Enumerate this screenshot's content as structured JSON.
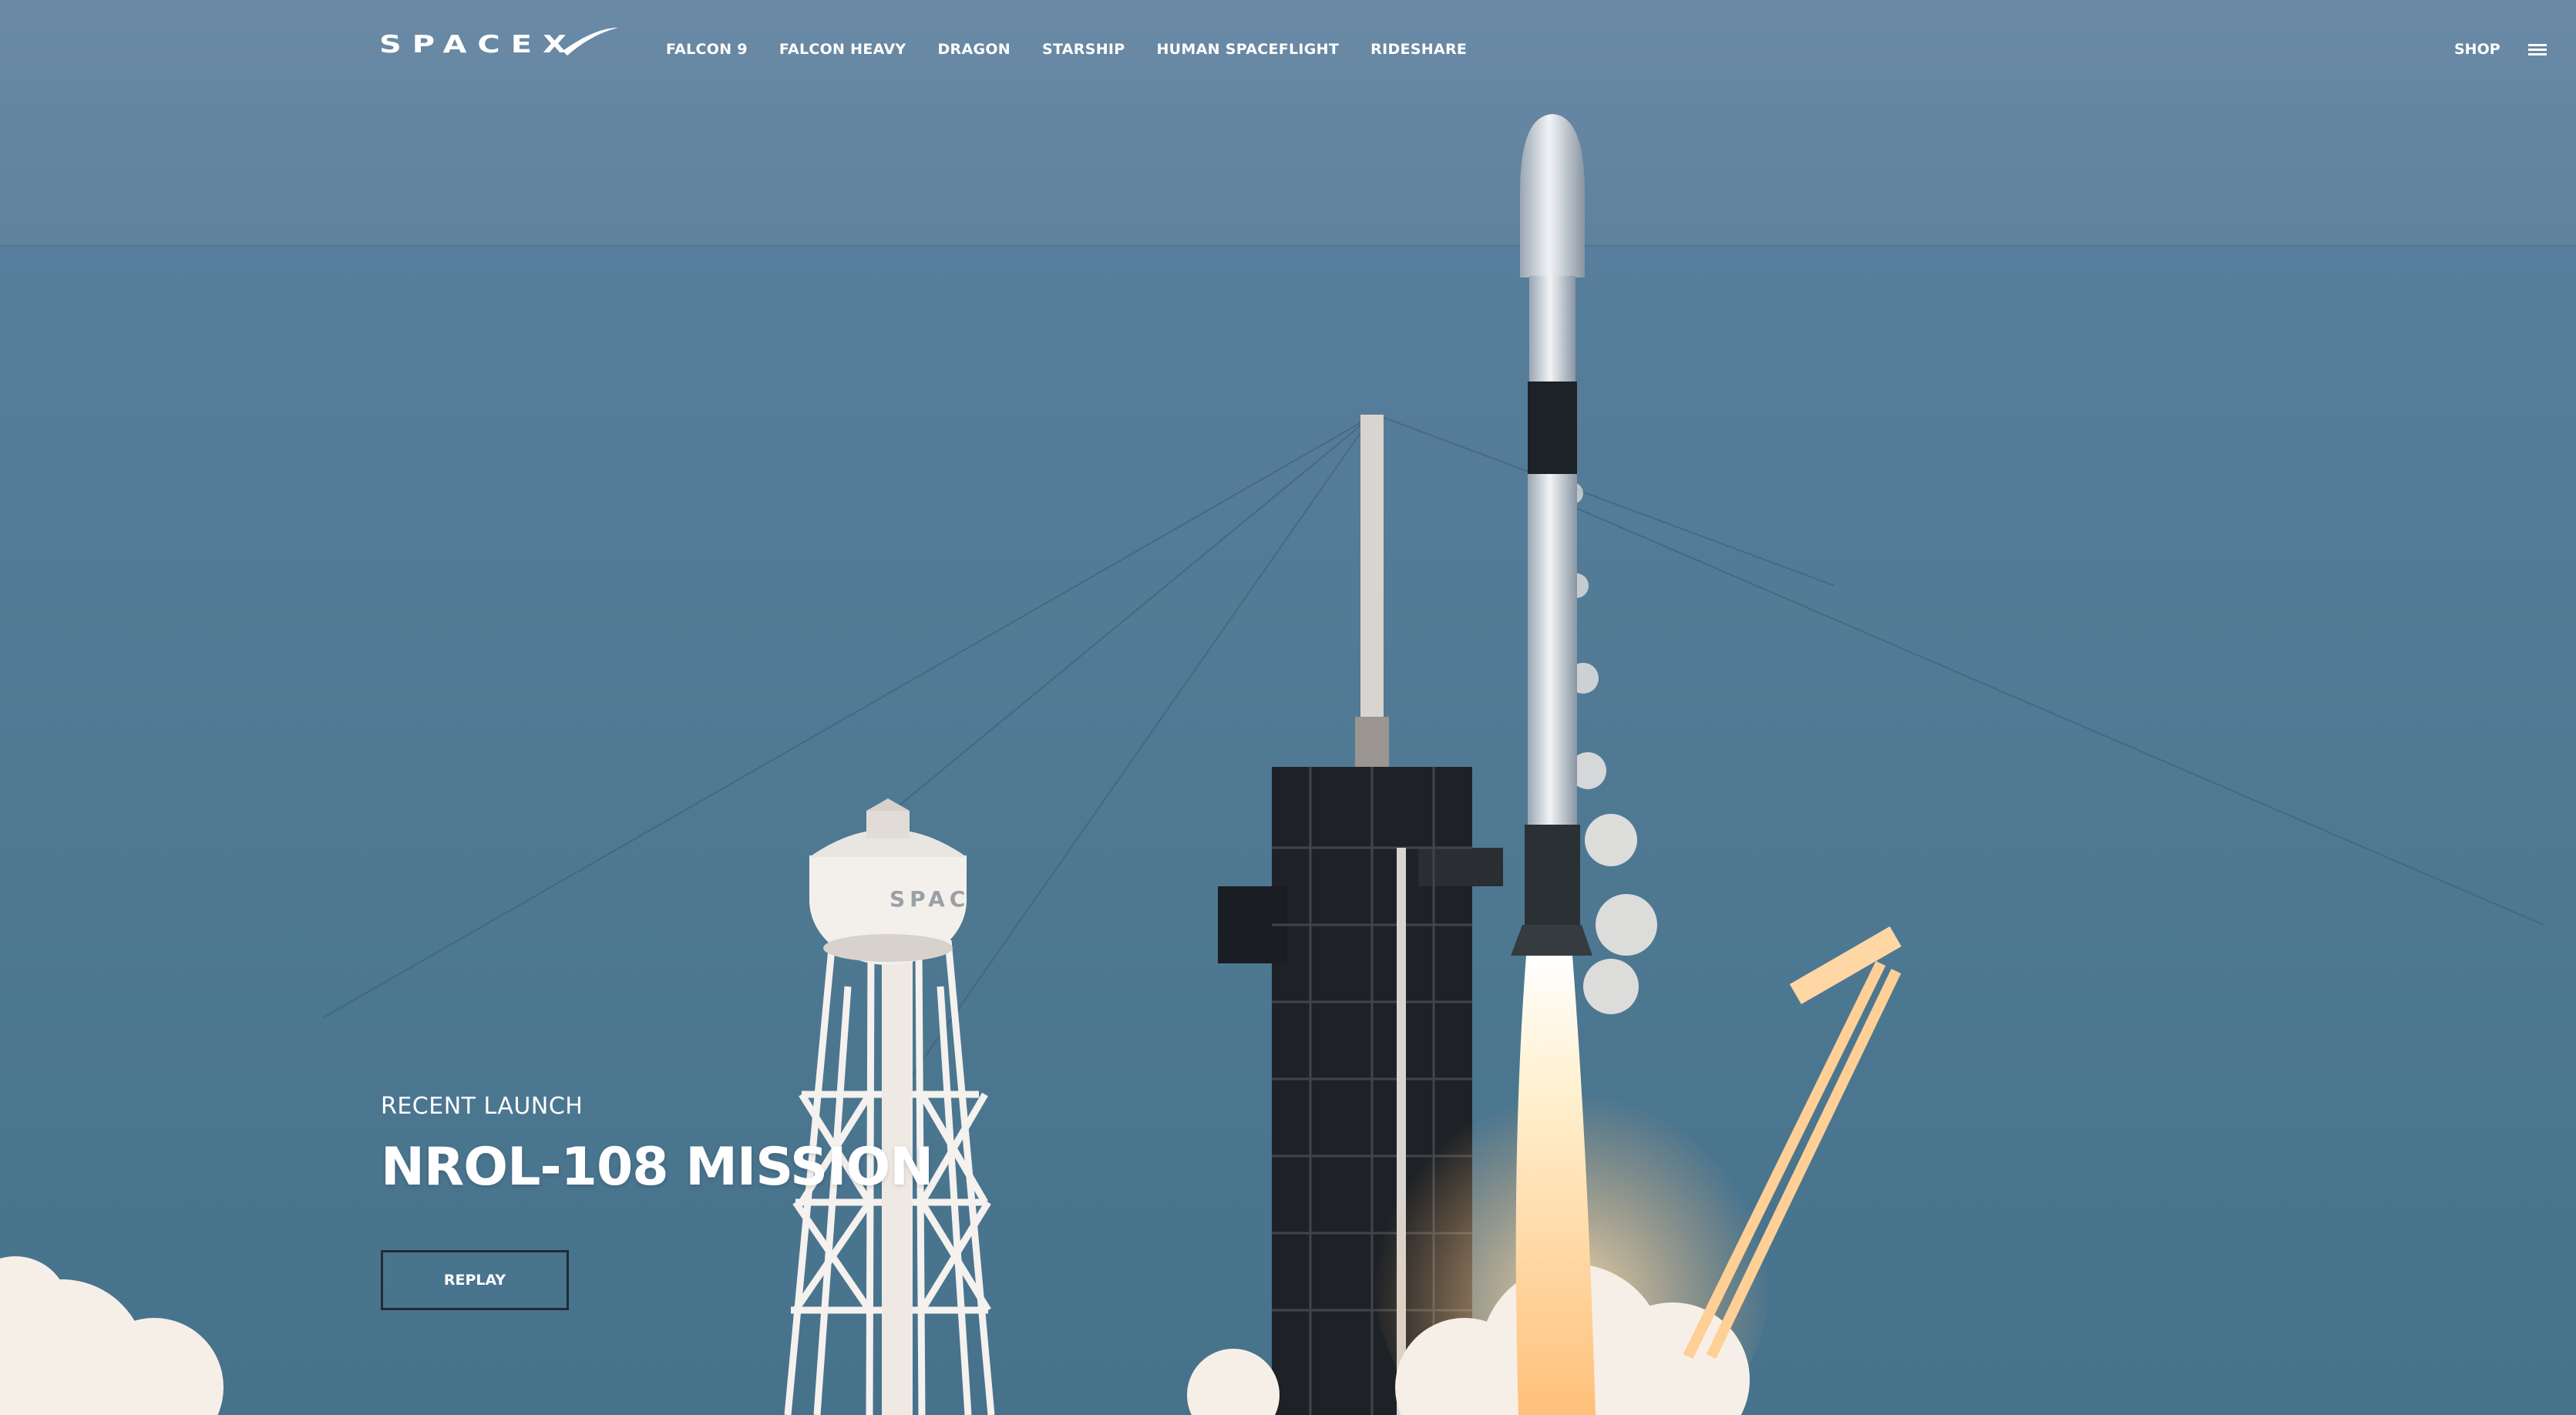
{
  "brand": {
    "name": "SPACEX",
    "logo_icon": "spacex-swoosh-logo",
    "text_color": "#ffffff"
  },
  "nav": {
    "links": [
      {
        "label": "FALCON 9"
      },
      {
        "label": "FALCON HEAVY"
      },
      {
        "label": "DRAGON"
      },
      {
        "label": "STARSHIP"
      },
      {
        "label": "HUMAN SPACEFLIGHT"
      },
      {
        "label": "RIDESHARE"
      }
    ],
    "shop_label": "SHOP",
    "menu_icon": "hamburger-menu-icon"
  },
  "hero": {
    "label": "RECENT LAUNCH",
    "title": "NROL-108 MISSION",
    "button_label": "REPLAY",
    "water_tower_text": "SPAC",
    "image_subject": "rocket-launch-photo",
    "colors": {
      "sky": "#6b8ca8",
      "ocean": "#4f7a97",
      "flame": "#ffd39a",
      "button_border": "#222a33"
    }
  }
}
